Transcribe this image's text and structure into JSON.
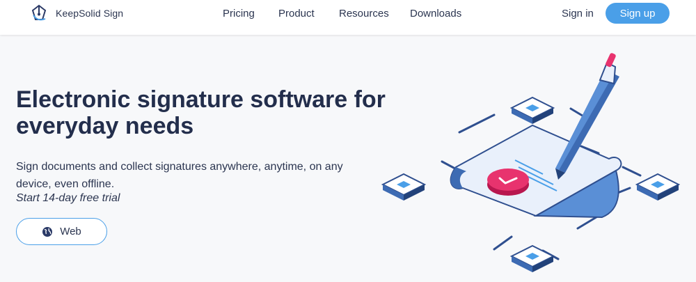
{
  "header": {
    "brand": "KeepSolid Sign",
    "nav": [
      {
        "label": "Pricing",
        "name": "nav-pricing"
      },
      {
        "label": "Product",
        "name": "nav-product"
      },
      {
        "label": "Resources",
        "name": "nav-resources"
      },
      {
        "label": "Downloads",
        "name": "nav-downloads"
      }
    ],
    "signin_label": "Sign in",
    "signup_label": "Sign up"
  },
  "hero": {
    "title": "Electronic signature software for everyday needs",
    "subtitle": "Sign documents and collect signatures anywhere, anytime, on any device, even offline.",
    "cta_text": "Start 14-day free trial",
    "web_button_label": "Web"
  },
  "icons": {
    "logo": "pen-nib-logo-icon",
    "web": "globe-icon"
  },
  "colors": {
    "accent": "#4a9fe8",
    "text_dark": "#232e4c",
    "header_bg": "#ffffff",
    "page_bg": "#f7f8fa",
    "signature_badge": "#e8336e",
    "illustration_blue": "#3d6bb3"
  }
}
